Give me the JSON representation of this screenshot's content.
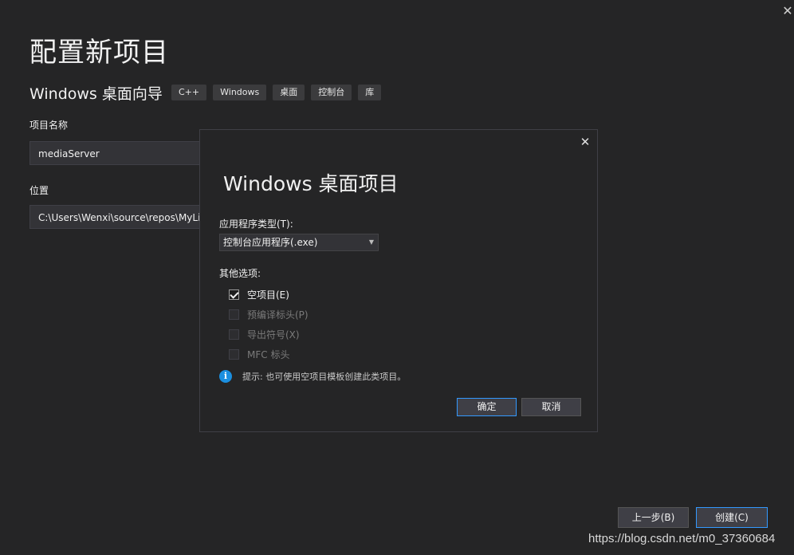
{
  "page": {
    "title": "配置新项目",
    "template_name": "Windows 桌面向导",
    "tags": [
      "C++",
      "Windows",
      "桌面",
      "控制台",
      "库"
    ],
    "project_name_label": "项目名称",
    "project_name_value": "mediaServer",
    "location_label": "位置",
    "location_value": "C:\\Users\\Wenxi\\source\\repos\\MyLi"
  },
  "footer": {
    "back_label": "上一步(B)",
    "create_label": "创建(C)"
  },
  "dialog": {
    "title": "Windows 桌面项目",
    "app_type_label": "应用程序类型(T):",
    "app_type_value": "控制台应用程序(.exe)",
    "other_options_label": "其他选项:",
    "options": [
      {
        "label": "空项目(E)",
        "checked": true,
        "enabled": true
      },
      {
        "label": "预编译标头(P)",
        "checked": false,
        "enabled": false
      },
      {
        "label": "导出符号(X)",
        "checked": false,
        "enabled": false
      },
      {
        "label": "MFC 标头",
        "checked": false,
        "enabled": false
      }
    ],
    "hint": "提示: 也可使用空项目模板创建此类项目。",
    "ok_label": "确定",
    "cancel_label": "取消"
  },
  "watermark": "https://blog.csdn.net/m0_37360684",
  "icons": {
    "close": "close-icon",
    "info": "info-icon",
    "dropdown": "chevron-down-icon"
  },
  "colors": {
    "background": "#252526",
    "accent": "#3399ff",
    "info": "#1b8fe0"
  }
}
